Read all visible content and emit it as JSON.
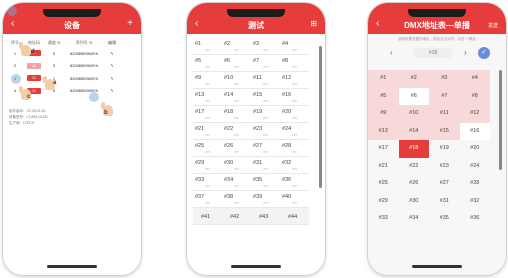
{
  "phone1": {
    "header": {
      "title": "设备",
      "left_icon": "back-icon",
      "right_icon": "+"
    },
    "table_headers": [
      "序号",
      "地址码",
      "通道 ⇅",
      "序列号 ⇅",
      "编辑"
    ],
    "rows": [
      {
        "index": "1",
        "address": "1",
        "channels": "5",
        "serial": "8205BB9960FA",
        "edit": "✎"
      },
      {
        "index": "2",
        "address": "11",
        "channels": "5",
        "serial": "8205BB9960FA",
        "edit": "✎"
      },
      {
        "index": "3",
        "address": "21",
        "channels": "1",
        "serial": "8205BB9960FA",
        "edit": "✎"
      },
      {
        "index": "4",
        "address": "31",
        "channels": "5",
        "serial": "8205BB9960FA",
        "edit": "✎"
      }
    ],
    "info": [
      "软件版本：V2.05.01.00",
      "设备型号：LT-895-OLED",
      "生产商：LTECH"
    ],
    "step_labels": [
      "a",
      "b",
      "c",
      "d"
    ]
  },
  "phone2": {
    "header": {
      "title": "测试",
      "left_icon": "back-icon",
      "right_icon": "grid-icon"
    },
    "cells": [
      [
        "#1",
        "#2",
        "#3",
        "#4"
      ],
      [
        "#5",
        "#6",
        "#7",
        "#8"
      ],
      [
        "#9",
        "#10",
        "#11",
        "#12"
      ],
      [
        "#13",
        "#14",
        "#15",
        "#16"
      ],
      [
        "#17",
        "#18",
        "#19",
        "#20"
      ],
      [
        "#21",
        "#22",
        "#23",
        "#24"
      ],
      [
        "#25",
        "#26",
        "#27",
        "#28"
      ],
      [
        "#29",
        "#30",
        "#31",
        "#32"
      ],
      [
        "#33",
        "#34",
        "#35",
        "#36"
      ],
      [
        "#37",
        "#38",
        "#39",
        "#40"
      ],
      [
        "#41",
        "#42",
        "#43",
        "#44"
      ]
    ],
    "sub_value": "255"
  },
  "phone3": {
    "header": {
      "title": "DMX地址表—单播",
      "left_icon": "back-icon",
      "right_text": "发送"
    },
    "subtitle": "选择所要设置的地址，然后点击对号，点击\"√\"确定",
    "picker": {
      "prev": "‹",
      "value": "#18",
      "next": "›",
      "confirm": "✓"
    },
    "cells": [
      [
        "#1",
        "#2",
        "#3",
        "#4"
      ],
      [
        "#5",
        "#6",
        "#7",
        "#8"
      ],
      [
        "#9",
        "#10",
        "#11",
        "#12"
      ],
      [
        "#13",
        "#14",
        "#15",
        "#16"
      ],
      [
        "#17",
        "#18",
        "#19",
        "#20"
      ],
      [
        "#21",
        "#22",
        "#23",
        "#24"
      ],
      [
        "#25",
        "#26",
        "#27",
        "#28"
      ],
      [
        "#29",
        "#30",
        "#31",
        "#32"
      ],
      [
        "#33",
        "#34",
        "#35",
        "#36"
      ]
    ],
    "colors": {
      "accent": "#e63c3c",
      "highlight": "#f7d9d9",
      "confirm": "#6b8bd8"
    }
  }
}
